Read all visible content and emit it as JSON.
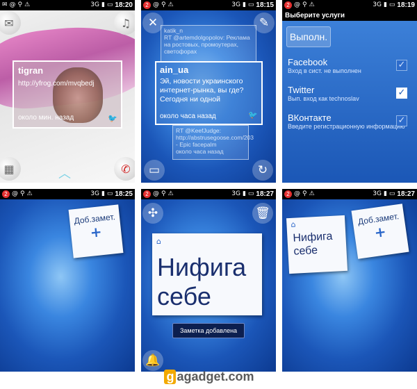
{
  "status_bar": {
    "time_1": "18:20",
    "time_2": "18:15",
    "time_3": "18:19",
    "time_4": "18:25",
    "time_5": "18:27",
    "time_6": "18:27",
    "badge": "2",
    "net": "3G"
  },
  "screen1": {
    "name": "tigran",
    "link": "http://yfrog.com/mvqbedj",
    "time": "около мин. назад"
  },
  "screen2": {
    "ghost_top_name": "katik_n",
    "ghost_top_body": "RT @artemdolgopolov: Реклама на ростовых, промоутерах, светофорах",
    "name": "ain_ua",
    "body": "Эй, новости украинского интернет-рынка, вы где? Сегодня ни одной",
    "time": "около часа назад",
    "ghost_bottom_body": "RT @KeefJudge: http://abstrusegoose.com/203 - Epic facepalm",
    "ghost_bottom_time": "около часа назад"
  },
  "screen3": {
    "header": "Выберите услуги",
    "done_label": "Выполн.",
    "services": [
      {
        "name": "Facebook",
        "desc": "Вход в сист. не выполнен",
        "checked": false
      },
      {
        "name": "Twitter",
        "desc": "Вып. вход как technoslav",
        "checked": true
      },
      {
        "name": "ВКонтакте",
        "desc": "Введите регистрационную информацию",
        "checked": false
      }
    ]
  },
  "notes": {
    "add_label": "Доб.замет.",
    "plus": "+",
    "note_text_line1": "Нифига",
    "note_text_line2": "себе",
    "toast": "Заметка добавлена"
  },
  "watermark": {
    "cap": "g",
    "rest": "agadget.com"
  },
  "colors": {
    "accent_blue": "#1f5fbf",
    "twitter_blue": "#5bc8f5",
    "pink": "#e77cc4"
  }
}
